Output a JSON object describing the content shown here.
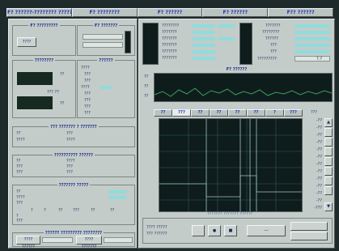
{
  "tabs": [
    "F? ??????-???????? ???????????",
    "F? ????????",
    "F? ??????",
    "F? ??????",
    "F?? ??????"
  ],
  "left": {
    "gen": {
      "title": "F? ?????????",
      "btn": "????"
    },
    "gen2": {
      "title": "F? ???????"
    },
    "station": {
      "title": "????????",
      "unit1": "??",
      "freq": "??? ??",
      "unit2": "??"
    },
    "spectrum": {
      "title": "??????",
      "rows": [
        "????",
        "???",
        "???",
        "????",
        "???",
        "???",
        "???",
        "???"
      ]
    },
    "carriers": {
      "title": "??? ??????? ? ???????",
      "r1": [
        "??",
        "???"
      ],
      "r2": [
        "????",
        "????"
      ]
    },
    "impulse": {
      "title": "?????????? ??????",
      "rows": [
        "??",
        "????",
        "???",
        "???",
        "???",
        "???"
      ]
    },
    "noise": {
      "title": "??????? ?????",
      "rows": [
        "??",
        "????",
        "???"
      ],
      "cols": [
        "?",
        "?",
        "??",
        "???",
        "??",
        "??"
      ],
      "rows2": [
        "?",
        "???"
      ]
    },
    "quality": {
      "title": "?????? ????????? ????????",
      "b1": "???? ??????",
      "b2": "???? ???????"
    }
  },
  "right": {
    "meas_labels": [
      "????????",
      "???????",
      "???????",
      "???????",
      "???????",
      "???????"
    ],
    "meas_labels2": [
      "???????",
      "????????",
      "??????",
      "???",
      "???",
      "?????????"
    ],
    "scale_value": "?.?",
    "spectrum_title": "F? ??????",
    "spec_scale": [
      "??",
      "??",
      "??"
    ],
    "subtabs": [
      "??",
      "???",
      "??",
      "??",
      "??",
      "??",
      "?",
      "???"
    ],
    "y_unit": "???",
    "y_ticks": [
      "-??",
      "-??",
      "-??",
      "-??",
      "-??",
      "-??",
      "-??",
      "-??",
      "-??",
      "-??",
      "-??",
      "-??",
      "-???"
    ],
    "footer": "??????? ??????? ??????",
    "bottom_labels": [
      "???? ?????",
      "??? ??????"
    ]
  }
}
